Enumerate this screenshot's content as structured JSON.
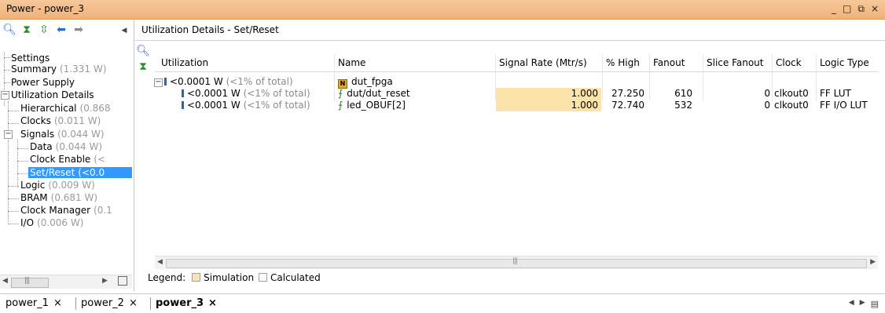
{
  "window": {
    "title": "Power - power_3",
    "controls": [
      "_",
      "□",
      "⧉",
      "×"
    ]
  },
  "tree": {
    "items": [
      {
        "label": "Settings",
        "value": ""
      },
      {
        "label": "Summary",
        "value": "(1.331 W)"
      },
      {
        "label": "Power Supply",
        "value": ""
      },
      {
        "label": "Utilization Details",
        "value": ""
      },
      {
        "label": "Hierarchical",
        "value": "(0.868"
      },
      {
        "label": "Clocks",
        "value": "(0.011 W)"
      },
      {
        "label": "Signals",
        "value": "(0.044 W)"
      },
      {
        "label": "Data",
        "value": "(0.044 W)"
      },
      {
        "label": "Clock Enable",
        "value": "(<"
      },
      {
        "label": "Set/Reset",
        "value": "(<0.0"
      },
      {
        "label": "Logic",
        "value": "(0.009 W)"
      },
      {
        "label": "BRAM",
        "value": "(0.681 W)"
      },
      {
        "label": "Clock Manager",
        "value": "(0.1"
      },
      {
        "label": "I/O",
        "value": "(0.006 W)"
      }
    ]
  },
  "pane": {
    "title": "Utilization Details - Set/Reset",
    "columns": [
      "Utilization",
      "Name",
      "Signal Rate (Mtr/s)",
      "% High",
      "Fanout",
      "Slice Fanout",
      "Clock",
      "Logic Type"
    ],
    "rows": [
      {
        "util": "<0.0001 W",
        "pct": "(<1% of total)",
        "name": "dut_fpga",
        "rate": "",
        "high": "",
        "fanout": "",
        "slice_fanout": "",
        "clock": "",
        "logic": ""
      },
      {
        "util": "<0.0001 W",
        "pct": "(<1% of total)",
        "name": "dut/dut_reset",
        "rate": "1.000",
        "high": "27.250",
        "fanout": "610",
        "slice_fanout": "0",
        "clock": "clkout0",
        "logic": "FF LUT"
      },
      {
        "util": "<0.0001 W",
        "pct": "(<1% of total)",
        "name": "led_OBUF[2]",
        "rate": "1.000",
        "high": "72.740",
        "fanout": "532",
        "slice_fanout": "0",
        "clock": "clkout0",
        "logic": "FF I/O LUT"
      }
    ],
    "legend": {
      "label": "Legend:",
      "simulation": "Simulation",
      "calculated": "Calculated"
    }
  },
  "tabs": [
    {
      "label": "power_1",
      "active": false
    },
    {
      "label": "power_2",
      "active": false
    },
    {
      "label": "power_3",
      "active": true
    }
  ],
  "colors": {
    "titlebar": "#f0b27a",
    "selection": "#3399ff",
    "simulation": "#fbe3a9"
  }
}
